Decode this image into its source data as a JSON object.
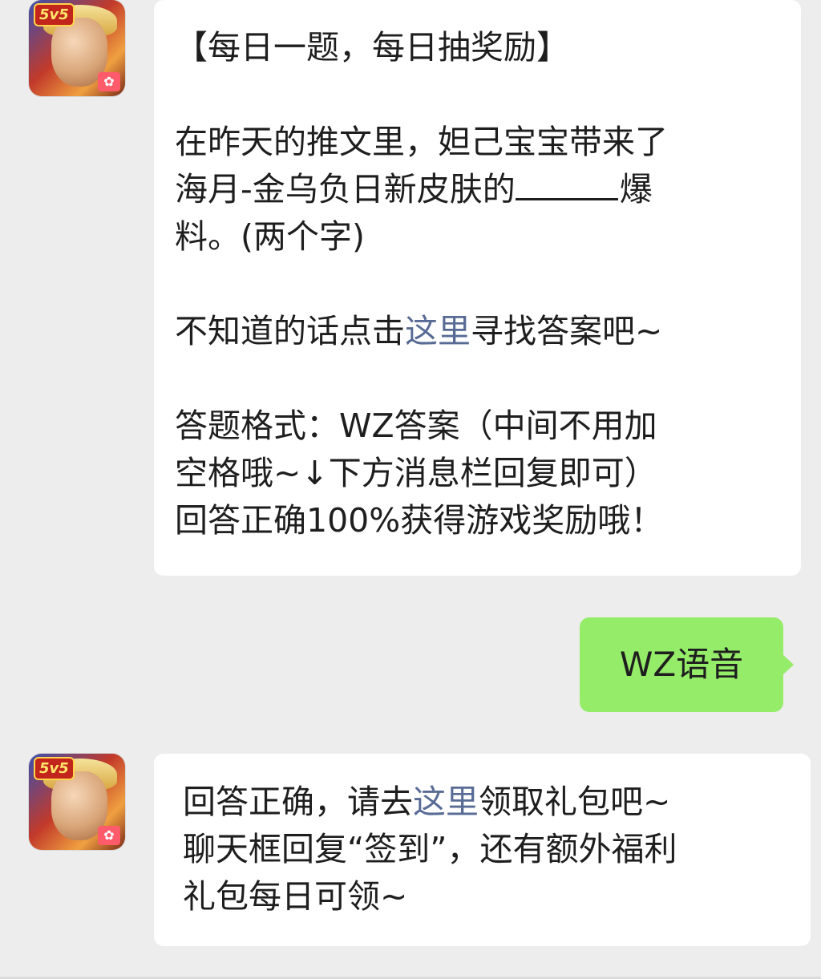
{
  "messages": {
    "first": {
      "title": "【每日一题，每日抽奖励】",
      "question_line1": "在昨天的推文里，妲己宝宝带来了",
      "question_line2_before": "海月-金乌负日新皮肤的",
      "question_line2_after": "爆",
      "question_line3": "料。(两个字)",
      "hint_before": "不知道的话点击",
      "hint_link": "这里",
      "hint_after": "寻找答案吧~",
      "format_line1": "答题格式：WZ答案（中间不用加",
      "format_line2": "空格哦~↓下方消息栏回复即可）",
      "format_line3": "回答正确100%获得游戏奖励哦！"
    },
    "reply": {
      "text": "WZ语音"
    },
    "second": {
      "line1_before": "回答正确，请去",
      "line1_link": "这里",
      "line1_after": "领取礼包吧~",
      "line2": "聊天框回复“签到”，还有额外福利",
      "line3": "礼包每日可领~"
    }
  },
  "avatar": {
    "badge": "5v5",
    "icon": "hero-portrait-icon"
  },
  "colors": {
    "background": "#ededed",
    "bubble_incoming": "#ffffff",
    "bubble_outgoing": "#95ec69",
    "link": "#576b95"
  }
}
